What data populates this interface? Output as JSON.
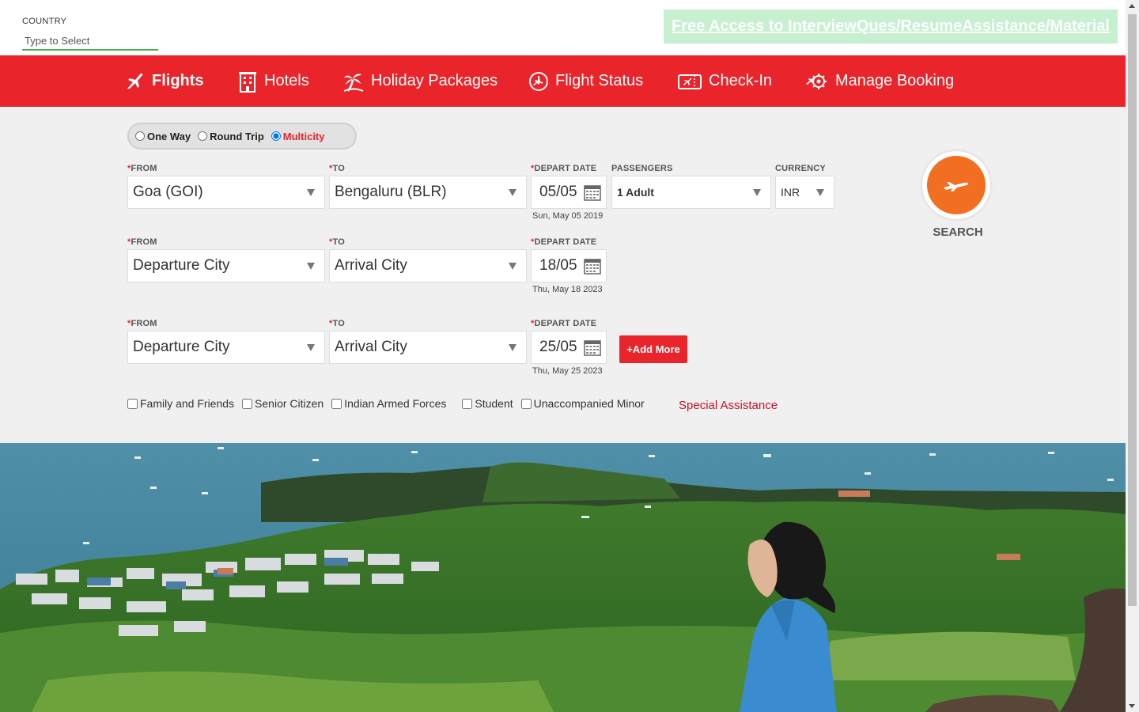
{
  "country": {
    "label": "COUNTRY",
    "placeholder": "Type to Select"
  },
  "promo": {
    "text": "Free Access to InterviewQues/ResumeAssistance/Material"
  },
  "nav": {
    "flights": "Flights",
    "hotels": "Hotels",
    "holiday": "Holiday Packages",
    "flight_status": "Flight Status",
    "checkin": "Check-In",
    "manage": "Manage Booking"
  },
  "trip_type": {
    "options": [
      "One Way",
      "Round Trip",
      "Multicity"
    ],
    "selected": "Multicity"
  },
  "labels": {
    "from": "FROM",
    "to": "TO",
    "depart_date": "DEPART DATE",
    "passengers": "PASSENGERS",
    "currency": "CURRENCY",
    "required_mark": "*"
  },
  "legs": [
    {
      "from": "Goa (GOI)",
      "to": "Bengaluru (BLR)",
      "date": "05/05",
      "date_full": "Sun, May 05 2019"
    },
    {
      "from": "Departure City",
      "to": "Arrival City",
      "date": "18/05",
      "date_full": "Thu, May 18 2023"
    },
    {
      "from": "Departure City",
      "to": "Arrival City",
      "date": "25/05",
      "date_full": "Thu, May 25 2023"
    }
  ],
  "passengers": "1 Adult",
  "currency": "INR",
  "add_more": "+Add More",
  "search": "SEARCH",
  "concessions": [
    "Family and Friends",
    "Senior Citizen",
    "Indian Armed Forces",
    "Student",
    "Unaccompanied Minor"
  ],
  "special_assistance": "Special Assistance",
  "colors": {
    "brand_red": "#e9242b",
    "search_orange": "#f26f21",
    "promo_bg": "#c6f0d0"
  },
  "icons": [
    "plane-icon",
    "hotel-icon",
    "palm-tree-icon",
    "flight-status-icon",
    "checkin-icon",
    "manage-booking-icon",
    "calendar-icon",
    "search-plane-icon"
  ]
}
